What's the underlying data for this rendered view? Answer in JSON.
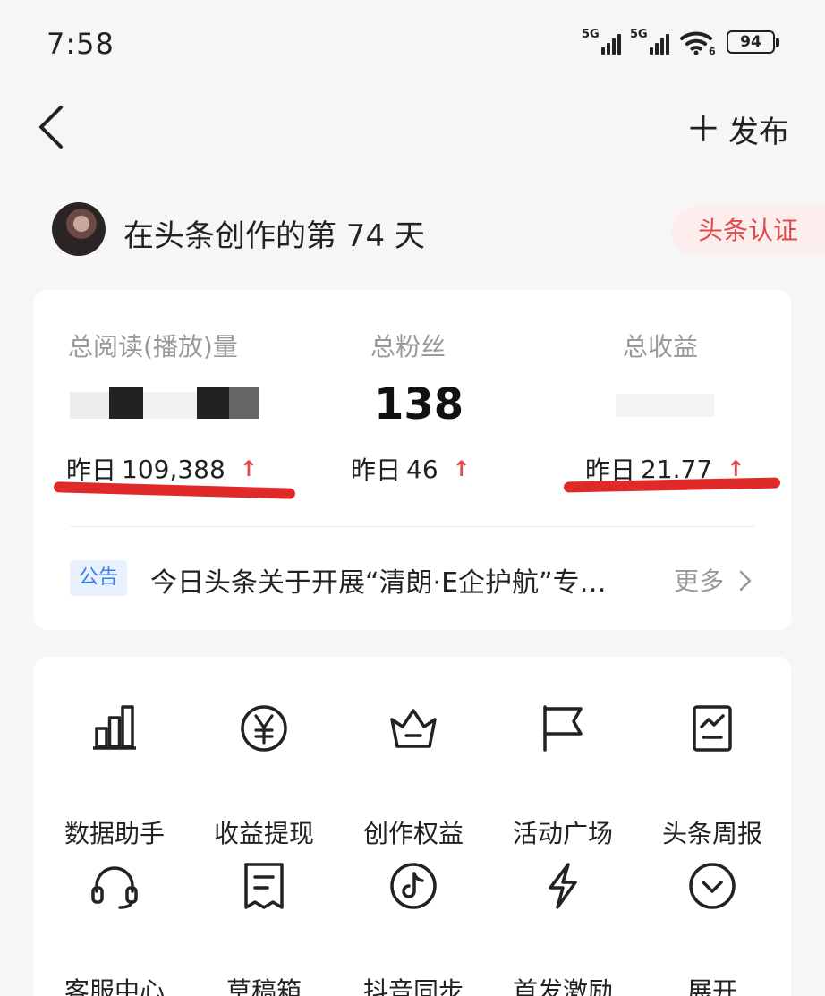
{
  "status_bar": {
    "time": "7:58",
    "sig1_label": "5G",
    "sig2_label": "5G",
    "wifi_label": "6",
    "battery": "94"
  },
  "topbar": {
    "publish_label": "发布"
  },
  "profile": {
    "days_text": "在头条创作的第 74 天",
    "verify_label": "头条认证"
  },
  "stats": [
    {
      "label": "总阅读(播放)量",
      "value": "",
      "yesterday_prefix": "昨日",
      "yesterday_value": "109,388"
    },
    {
      "label": "总粉丝",
      "value": "138",
      "yesterday_prefix": "昨日",
      "yesterday_value": "46"
    },
    {
      "label": "总收益",
      "value": "",
      "yesterday_prefix": "昨日",
      "yesterday_value": "21.77"
    }
  ],
  "notice": {
    "tag": "公告",
    "text": "今日头条关于开展“清朗·E企护航”专…",
    "more": "更多"
  },
  "tools": [
    {
      "label": "数据助手",
      "icon": "bar-chart-icon"
    },
    {
      "label": "收益提现",
      "icon": "yuan-icon"
    },
    {
      "label": "创作权益",
      "icon": "crown-icon"
    },
    {
      "label": "活动广场",
      "icon": "flag-icon"
    },
    {
      "label": "头条周报",
      "icon": "report-icon"
    },
    {
      "label": "客服中心",
      "icon": "headset-icon"
    },
    {
      "label": "草稿箱",
      "icon": "draft-icon"
    },
    {
      "label": "抖音同步",
      "icon": "douyin-icon"
    },
    {
      "label": "首发激励",
      "icon": "lightning-icon"
    },
    {
      "label": "展开",
      "icon": "expand-icon"
    }
  ],
  "colors": {
    "accent": "#e24a4a",
    "notice_blue": "#3a7ee6",
    "annotation_red": "#e02a2a"
  }
}
